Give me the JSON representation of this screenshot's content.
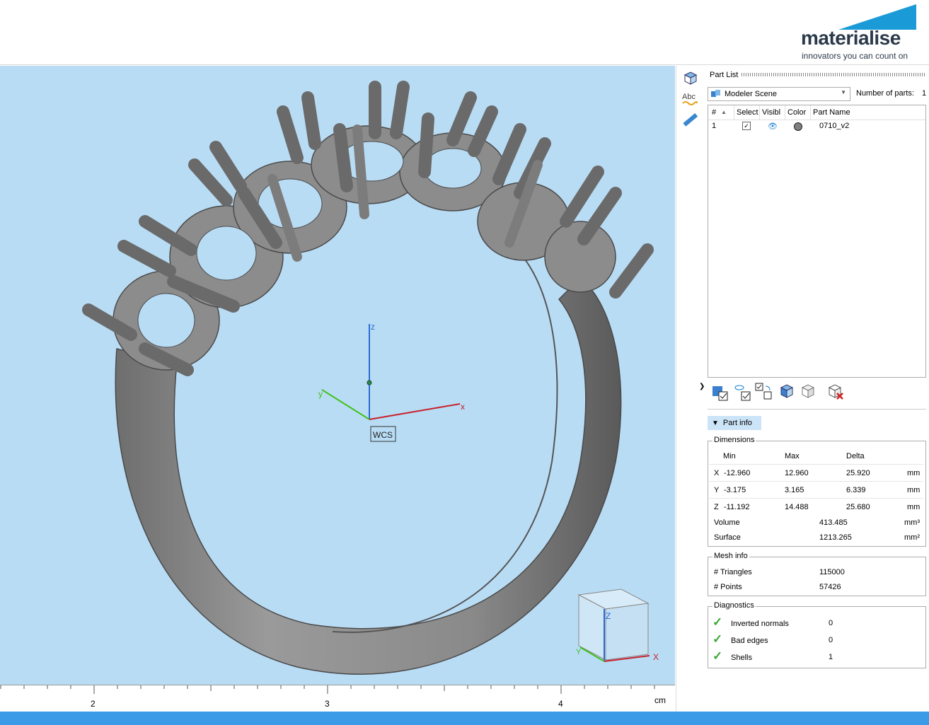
{
  "brand": {
    "name": "materialise",
    "tagline": "innovators you can count on",
    "accent": "#1a9ad6"
  },
  "viewport": {
    "background": "#b9dcf5",
    "axes": {
      "x": "x",
      "y": "y",
      "z": "z"
    },
    "wcs_label": "WCS",
    "cube_axes": {
      "x": "X",
      "y": "Y",
      "z": "Z"
    }
  },
  "ruler": {
    "ticks": [
      "2",
      "3",
      "4"
    ],
    "unit": "cm"
  },
  "toolbar": {
    "icons": [
      "view-cube-icon",
      "text-label-icon",
      "measure-ruler-icon"
    ]
  },
  "part_list": {
    "title": "Part List",
    "scene": "Modeler Scene",
    "number_of_parts_label": "Number of parts:",
    "number_of_parts": "1",
    "columns": [
      "#",
      "Select",
      "Visibl",
      "Color",
      "Part Name"
    ],
    "rows": [
      {
        "num": "1",
        "selected": true,
        "visible": true,
        "color": "#808080",
        "name": "0710_v2"
      }
    ],
    "actions": [
      "select-all-icon",
      "visibility-toggle-icon",
      "invert-selection-icon",
      "show-parts-icon",
      "hide-parts-icon",
      "delete-part-icon"
    ]
  },
  "part_info": {
    "toggle_label": "Part info",
    "dimensions": {
      "title": "Dimensions",
      "headers": [
        "Min",
        "Max",
        "Delta"
      ],
      "rows": [
        {
          "axis": "X",
          "min": "-12.960",
          "max": "12.960",
          "delta": "25.920",
          "unit": "mm"
        },
        {
          "axis": "Y",
          "min": "-3.175",
          "max": "3.165",
          "delta": "6.339",
          "unit": "mm"
        },
        {
          "axis": "Z",
          "min": "-11.192",
          "max": "14.488",
          "delta": "25.680",
          "unit": "mm"
        }
      ],
      "volume_label": "Volume",
      "volume": "413.485",
      "volume_unit": "mm³",
      "surface_label": "Surface",
      "surface": "1213.265",
      "surface_unit": "mm²"
    },
    "mesh": {
      "title": "Mesh info",
      "triangles_label": "# Triangles",
      "triangles": "115000",
      "points_label": "# Points",
      "points": "57426"
    },
    "diagnostics": {
      "title": "Diagnostics",
      "items": [
        {
          "label": "Inverted normals",
          "value": "0"
        },
        {
          "label": "Bad edges",
          "value": "0"
        },
        {
          "label": "Shells",
          "value": "1"
        }
      ]
    }
  }
}
